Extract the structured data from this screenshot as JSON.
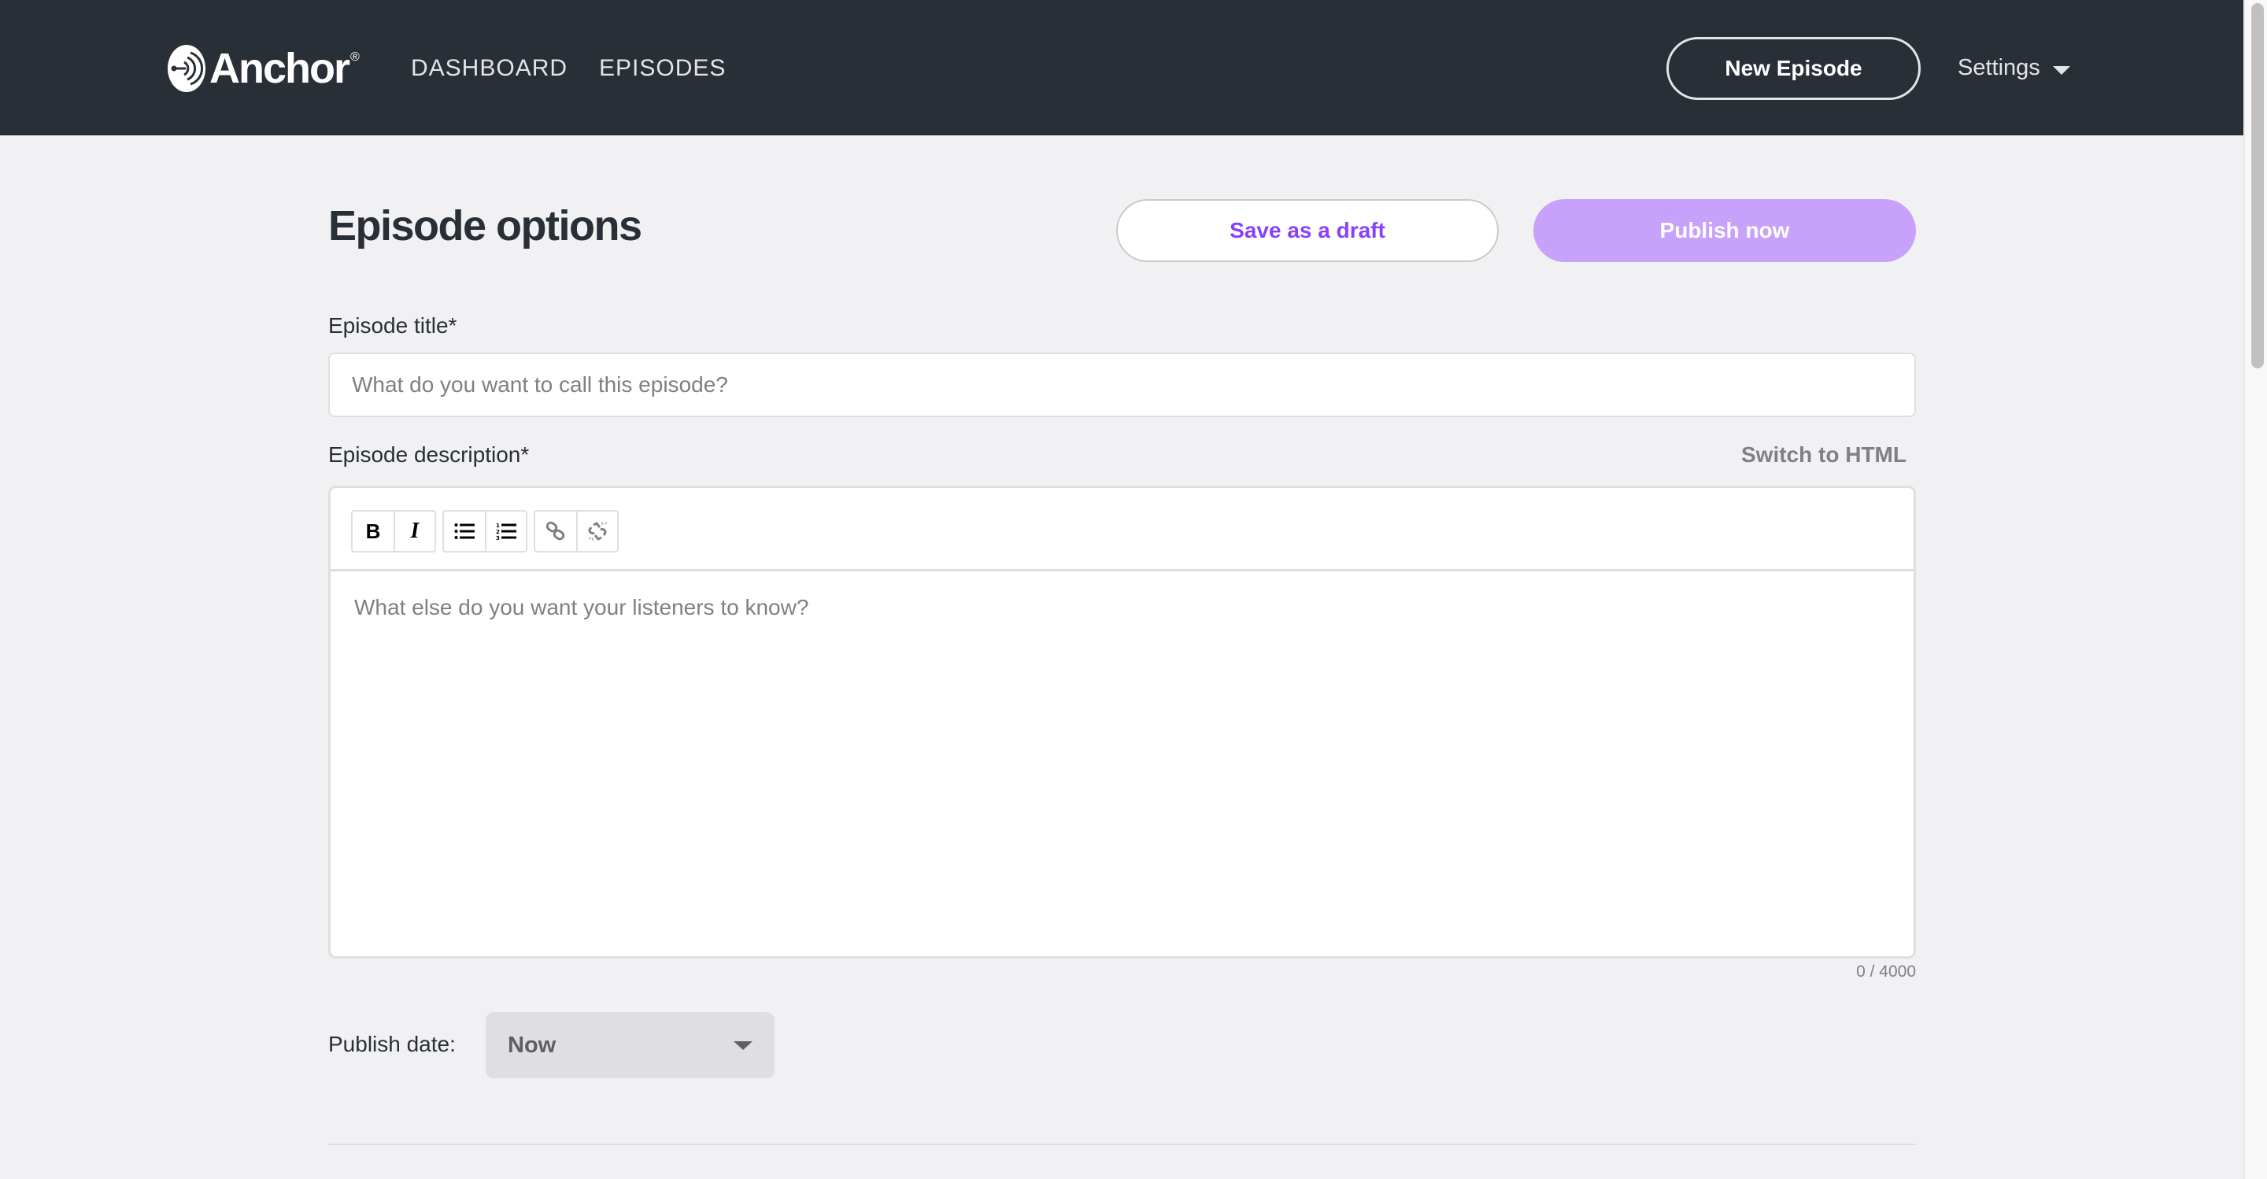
{
  "header": {
    "brand": "Anchor",
    "brand_mark": "®",
    "nav": [
      {
        "label": "DASHBOARD"
      },
      {
        "label": "EPISODES"
      }
    ],
    "new_episode_label": "New Episode",
    "settings_label": "Settings"
  },
  "main": {
    "title": "Episode options",
    "save_draft_label": "Save as a draft",
    "publish_label": "Publish now",
    "episode_title": {
      "label": "Episode title*",
      "value": "",
      "placeholder": "What do you want to call this episode?"
    },
    "episode_description": {
      "label": "Episode description*",
      "switch_label": "Switch to HTML",
      "value": "",
      "placeholder": "What else do you want your listeners to know?",
      "char_count": "0 / 4000",
      "toolbar": [
        {
          "icon": "bold-icon",
          "glyph": "B"
        },
        {
          "icon": "italic-icon",
          "glyph": "I"
        },
        {
          "icon": "bullet-list-icon"
        },
        {
          "icon": "numbered-list-icon"
        },
        {
          "icon": "link-icon"
        },
        {
          "icon": "unlink-icon"
        }
      ]
    },
    "publish_date": {
      "label": "Publish date:",
      "selected": "Now"
    }
  },
  "colors": {
    "header_bg": "#292f36",
    "page_bg": "#f1f1f3",
    "accent_purple": "#8940fa",
    "publish_disabled": "#c8a1fb"
  }
}
